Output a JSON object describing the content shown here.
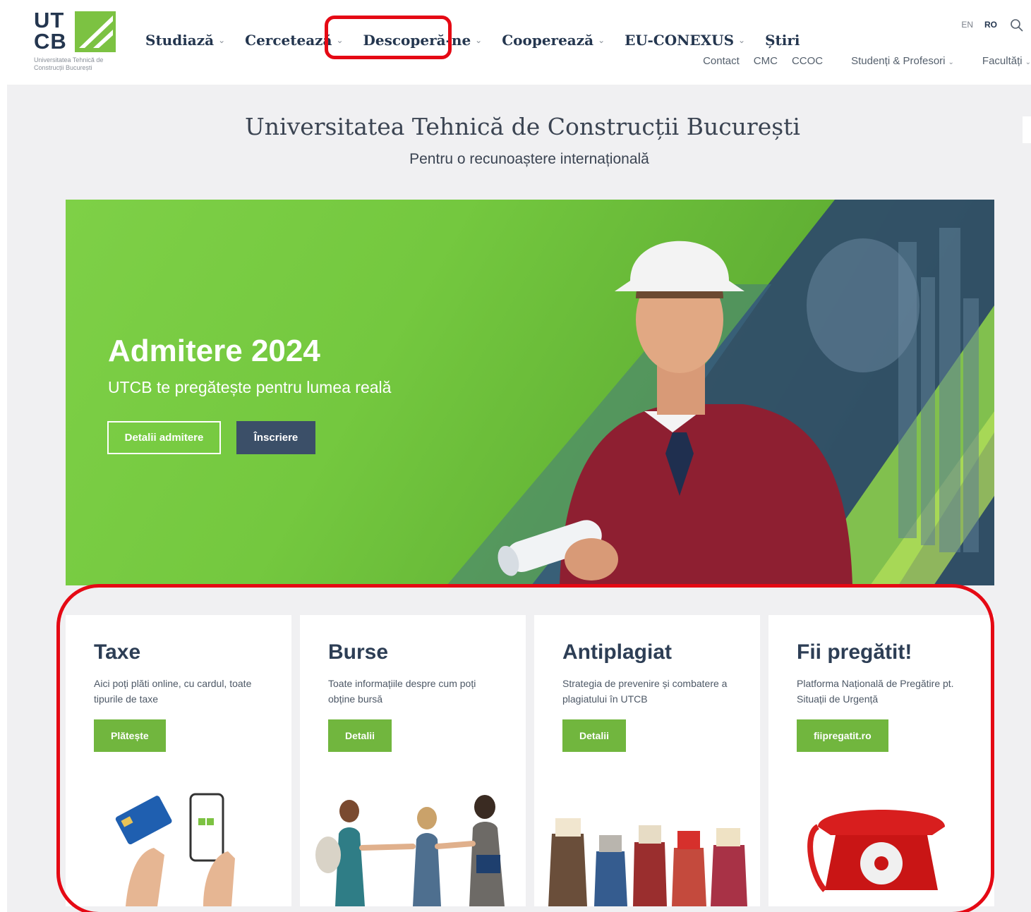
{
  "logo": {
    "line1": "UT",
    "line2": "CB",
    "subtitle": "Universitatea Tehnică de Construcții București"
  },
  "nav": {
    "items": [
      {
        "label": "Studiază",
        "chevron": "⌄"
      },
      {
        "label": "Cercetează",
        "chevron": "⌄"
      },
      {
        "label": "Descoperă-ne",
        "chevron": "⌄"
      },
      {
        "label": "Cooperează",
        "chevron": "⌄"
      },
      {
        "label": "EU-CONEXUS",
        "chevron": "⌄"
      },
      {
        "label": "Știri",
        "chevron": ""
      }
    ],
    "lang_en": "EN",
    "lang_ro": "RO",
    "search_icon": "search-icon"
  },
  "subnav": {
    "contact": "Contact",
    "cmc": "CMC",
    "ccoc": "CCOC",
    "students": "Studenți & Profesori",
    "faculties": "Facultăți",
    "chevron": "⌄"
  },
  "hero": {
    "title": "Universitatea Tehnică de Construcții București",
    "subtitle": "Pentru o recunoaștere internațională"
  },
  "banner": {
    "title": "Admitere 2024",
    "subtitle": "UTCB te pregătește pentru lumea reală",
    "btn_details": "Detalii admitere",
    "btn_register": "Înscriere"
  },
  "cards": [
    {
      "title": "Taxe",
      "desc": "Aici poți plăti online, cu cardul, toate tipurile de taxe",
      "button": "Plătește"
    },
    {
      "title": "Burse",
      "desc": "Toate informațiile despre cum poți obține bursă",
      "button": "Detalii"
    },
    {
      "title": "Antiplagiat",
      "desc": "Strategia de prevenire și combatere a plagiatului în UTCB",
      "button": "Detalii"
    },
    {
      "title": "Fii pregătit!",
      "desc": "Platforma Națională de Pregătire pt. Situații de Urgență",
      "button": "fiipregatit.ro"
    }
  ],
  "colors": {
    "brand_green": "#71b63e",
    "navy": "#24364f",
    "highlight_red": "#e50914",
    "button_dark": "#3b4f68"
  }
}
